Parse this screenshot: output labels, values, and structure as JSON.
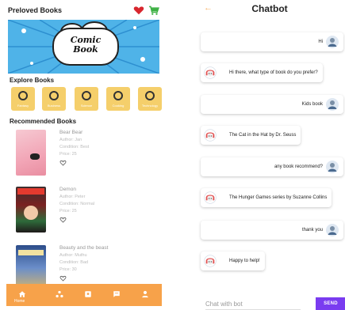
{
  "left": {
    "title": "Preloved Books",
    "banner_text": "Comic\nBook",
    "explore_title": "Explore Books",
    "categories": [
      {
        "label": "Fantasy",
        "color": "#f5cf6b"
      },
      {
        "label": "Business",
        "color": "#f5cf6b"
      },
      {
        "label": "Science",
        "color": "#f5cf6b"
      },
      {
        "label": "Cooking",
        "color": "#f5cf6b"
      },
      {
        "label": "Technology",
        "color": "#f5cf6b"
      }
    ],
    "recommended_title": "Recommended Books",
    "books": [
      {
        "name": "Bear Bear",
        "author": "Author: Jan",
        "condition": "Condition: Best",
        "price": "Price: 25"
      },
      {
        "name": "Demon",
        "author": "Author: Peter",
        "condition": "Condition: Normal",
        "price": "Price: 25"
      },
      {
        "name": "Beauty and the beast",
        "author": "Author: Muthu",
        "condition": "Condition: Bad",
        "price": "Price: 30"
      }
    ],
    "nav": {
      "home_label": "Home",
      "accent": "#f7a24a"
    }
  },
  "right": {
    "back_icon": "←",
    "title": "Chatbot",
    "messages": [
      {
        "from": "user",
        "text": "Hi"
      },
      {
        "from": "bot",
        "text": "Hi there, what type of book do you prefer?"
      },
      {
        "from": "user",
        "text": "Kids book"
      },
      {
        "from": "bot",
        "text": "The Cat in the Hat by Dr. Seuss"
      },
      {
        "from": "user",
        "text": "any book recommend?"
      },
      {
        "from": "bot",
        "text": "The Hunger Games series by Suzanne Collins"
      },
      {
        "from": "user",
        "text": "thank you"
      },
      {
        "from": "bot",
        "text": "Happy to help!"
      }
    ],
    "input_placeholder": "Chat with bot",
    "send_label": "SEND",
    "send_color": "#7a3cf0"
  }
}
